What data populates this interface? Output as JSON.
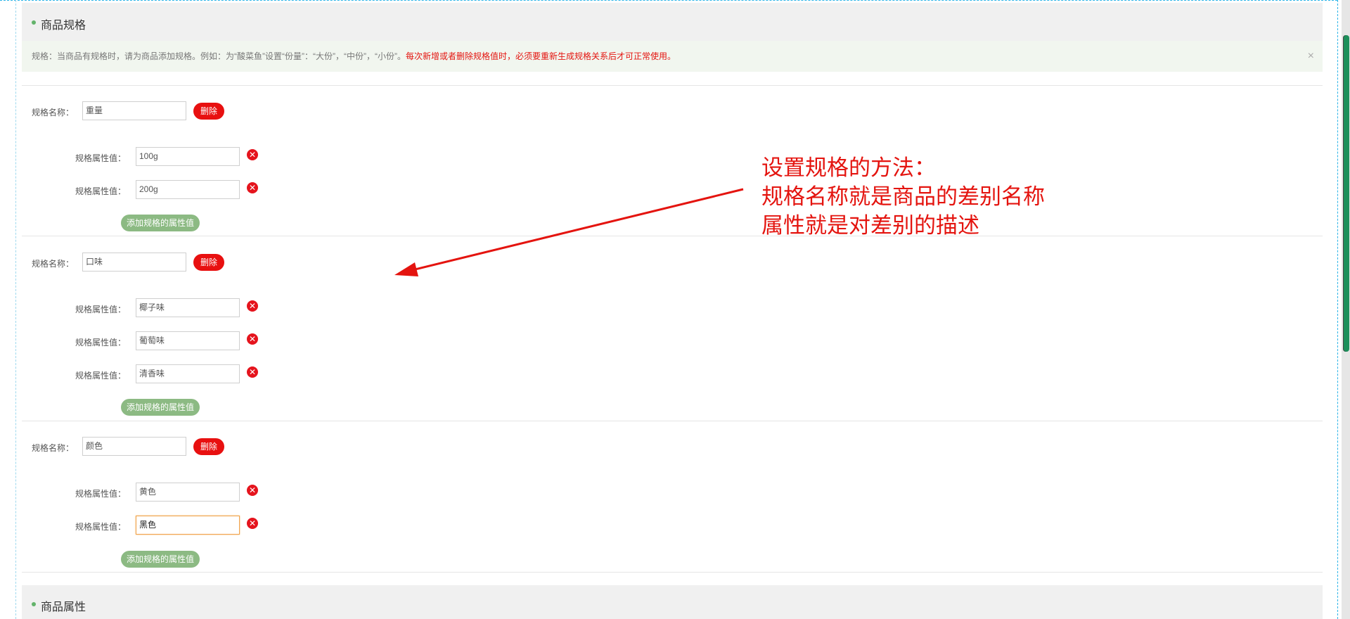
{
  "section_spec": {
    "title": "商品规格"
  },
  "notice": {
    "text": "规格：当商品有规格时，请为商品添加规格。例如：为“酸菜鱼”设置“份量”：“大份”，“中份”，“小份”。",
    "warning": "每次新增或者删除规格值时，必须要重新生成规格关系后才可正常使用。",
    "close": "×"
  },
  "labels": {
    "spec_name": "规格名称：",
    "attr_value": "规格属性值：",
    "delete": "删除",
    "add_attr": "添加规格的属性值",
    "remove": "✕"
  },
  "specs": [
    {
      "name": "重量",
      "values": [
        "100g",
        "200g"
      ]
    },
    {
      "name": "口味",
      "values": [
        "椰子味",
        "葡萄味",
        "清香味"
      ]
    },
    {
      "name": "颜色",
      "values": [
        "黄色",
        "黑色"
      ]
    }
  ],
  "annotation": {
    "line1": "设置规格的方法：",
    "line2": "规格名称就是商品的差别名称",
    "line3": "属性就是对差别的描述",
    "color": "#e4140f"
  },
  "section_attr": {
    "title": "商品属性"
  },
  "colors": {
    "delete_button": "#e81010",
    "add_button": "#8cba83",
    "remove_icon": "#e5141d",
    "accent_dot": "#63b36b"
  }
}
